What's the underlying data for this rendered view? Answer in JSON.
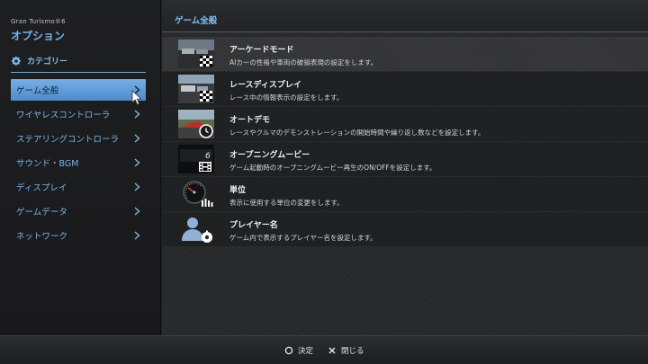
{
  "app": {
    "brand": "Gran Turismo®6",
    "title": "オプション"
  },
  "sidebar": {
    "category_label": "カテゴリー",
    "items": [
      {
        "label": "ゲーム全般"
      },
      {
        "label": "ワイヤレスコントローラ"
      },
      {
        "label": "ステアリングコントローラ"
      },
      {
        "label": "サウンド・BGM"
      },
      {
        "label": "ディスプレイ"
      },
      {
        "label": "ゲームデータ"
      },
      {
        "label": "ネットワーク"
      }
    ]
  },
  "main": {
    "section_title": "ゲーム全般",
    "rows": [
      {
        "title": "アーケードモード",
        "desc": "AIカーの性格や車両の破損表現の設定をします。",
        "icon": "arcade-thumbnail"
      },
      {
        "title": "レースディスプレイ",
        "desc": "レース中の情報表示の設定をします。",
        "icon": "race-display-thumbnail"
      },
      {
        "title": "オートデモ",
        "desc": "レースやクルマのデモンストレーションの開始時間や繰り返し数などを設定します。",
        "icon": "auto-demo-thumbnail"
      },
      {
        "title": "オープニングムービー",
        "desc": "ゲーム起動時のオープニングムービー再生のON/OFFを設定します。",
        "icon": "opening-movie-thumbnail"
      },
      {
        "title": "単位",
        "desc": "表示に使用する単位の変更をします。",
        "icon": "units-gauge-thumbnail"
      },
      {
        "title": "プレイヤー名",
        "desc": "ゲーム内で表示するプレイヤー名を設定します。",
        "icon": "player-name-thumbnail"
      }
    ]
  },
  "footer": {
    "confirm": "決定",
    "close": "閉じる"
  },
  "colors": {
    "accent": "#6fb4ec",
    "active_item": "#5f9dd9",
    "background": "#1c1d1f"
  }
}
